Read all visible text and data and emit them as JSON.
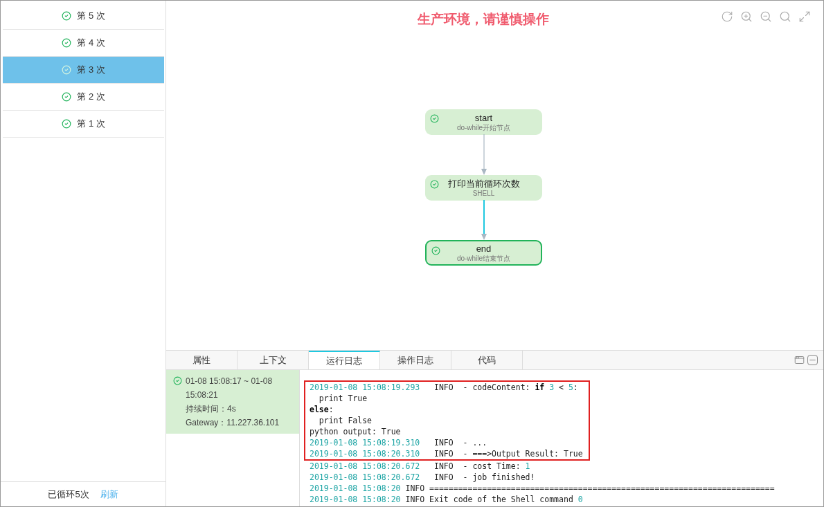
{
  "iterations": [
    {
      "label": "第 5 次",
      "succeeded": true,
      "selected": false
    },
    {
      "label": "第 4 次",
      "succeeded": true,
      "selected": false
    },
    {
      "label": "第 3 次",
      "succeeded": true,
      "selected": true
    },
    {
      "label": "第 2 次",
      "succeeded": true,
      "selected": false
    },
    {
      "label": "第 1 次",
      "succeeded": true,
      "selected": false
    }
  ],
  "footer": {
    "count": "已循环5次",
    "refresh": "刷新"
  },
  "warning": "生产环境，请谨慎操作",
  "toolbar": [
    {
      "kind": "refresh"
    },
    {
      "kind": "zoom-in"
    },
    {
      "kind": "zoom-out"
    },
    {
      "kind": "search"
    },
    {
      "kind": "fullscreen"
    }
  ],
  "nodes": [
    {
      "title": "start",
      "subtitle": "do-while开始节点",
      "succeeded": true,
      "selected": false
    },
    {
      "title": "打印当前循环次数",
      "subtitle": "SHELL",
      "succeeded": true,
      "selected": false
    },
    {
      "title": "end",
      "subtitle": "do-while结束节点",
      "succeeded": true,
      "selected": true
    }
  ],
  "edges": [
    {
      "active": false
    },
    {
      "active": true
    }
  ],
  "tabs": [
    {
      "label": "属性",
      "selected": false
    },
    {
      "label": "上下文",
      "selected": false
    },
    {
      "label": "运行日志",
      "selected": true
    },
    {
      "label": "操作日志",
      "selected": false
    },
    {
      "label": "代码",
      "selected": false
    }
  ],
  "run": {
    "succeeded": true,
    "time": "01-08 15:08:17 ~ 01-08 15:08:21",
    "duration": "持续时间：4s",
    "gateway": "Gateway：11.227.36.101"
  },
  "log_highlighted": [
    {
      "parts": [
        {
          "kind": "time",
          "text": "2019-01-08 15:08:19.293"
        },
        {
          "kind": "text",
          "text": "   INFO  - codeContent: "
        },
        {
          "kind": "kw",
          "text": "if"
        },
        {
          "kind": "num",
          "text": " 3"
        },
        {
          "kind": "text",
          "text": " < "
        },
        {
          "kind": "num",
          "text": "5"
        },
        {
          "kind": "text",
          "text": ":"
        }
      ]
    },
    {
      "parts": [
        {
          "kind": "text",
          "text": "  print True"
        }
      ]
    },
    {
      "parts": [
        {
          "kind": "kw",
          "text": "else"
        },
        {
          "kind": "text",
          "text": ":"
        }
      ]
    },
    {
      "parts": [
        {
          "kind": "text",
          "text": "  print False"
        }
      ]
    },
    {
      "parts": [
        {
          "kind": "text",
          "text": "python output: True"
        }
      ]
    },
    {
      "parts": [
        {
          "kind": "time",
          "text": "2019-01-08 15:08:19.310"
        },
        {
          "kind": "text",
          "text": "   INFO  - ..."
        }
      ]
    },
    {
      "parts": [
        {
          "kind": "time",
          "text": "2019-01-08 15:08:20.310"
        },
        {
          "kind": "text",
          "text": "   INFO  - ===>Output Result: True"
        }
      ]
    }
  ],
  "log": [
    {
      "parts": [
        {
          "kind": "time",
          "text": "2019-01-08 15:08:20.672"
        },
        {
          "kind": "text",
          "text": "   INFO  - cost Time: "
        },
        {
          "kind": "num",
          "text": "1"
        }
      ]
    },
    {
      "parts": [
        {
          "kind": "time",
          "text": "2019-01-08 15:08:20.672"
        },
        {
          "kind": "text",
          "text": "   INFO  - job finished!"
        }
      ]
    },
    {
      "parts": [
        {
          "kind": "time",
          "text": "2019-01-08 15:08:20"
        },
        {
          "kind": "text",
          "text": " INFO ========================================================================"
        }
      ]
    },
    {
      "parts": [
        {
          "kind": "time",
          "text": "2019-01-08 15:08:20"
        },
        {
          "kind": "text",
          "text": " INFO Exit code of the Shell command "
        },
        {
          "kind": "num",
          "text": "0"
        }
      ]
    }
  ]
}
